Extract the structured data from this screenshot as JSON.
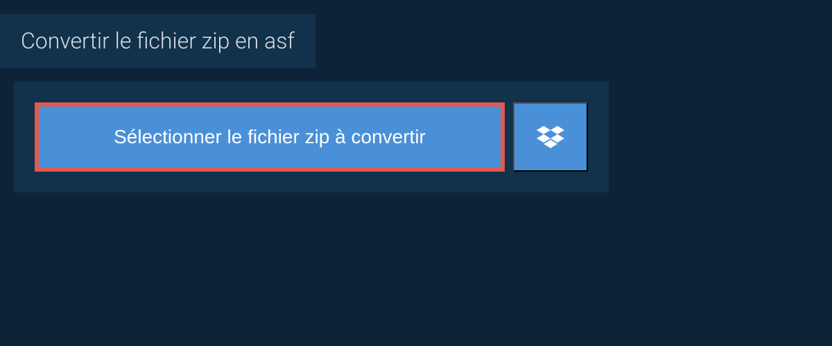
{
  "header": {
    "title": "Convertir le fichier zip en asf"
  },
  "panel": {
    "select_button_label": "Sélectionner le fichier zip à convertir"
  },
  "colors": {
    "background": "#0d2438",
    "panel": "#12314b",
    "button": "#4a90d9",
    "highlight": "#e05a4f",
    "text_light": "#d8dde3",
    "text_white": "#ffffff"
  }
}
